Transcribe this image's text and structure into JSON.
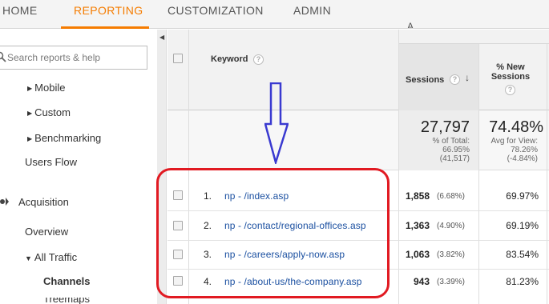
{
  "nav": {
    "tabs": [
      {
        "label": "HOME"
      },
      {
        "label": "REPORTING"
      },
      {
        "label": "CUSTOMIZATION"
      },
      {
        "label": "ADMIN"
      }
    ]
  },
  "sidebar": {
    "search_placeholder": "Search reports & help",
    "items": [
      {
        "label": "Mobile"
      },
      {
        "label": "Custom"
      },
      {
        "label": "Benchmarking"
      },
      {
        "label": "Users Flow"
      },
      {
        "label": "Acquisition"
      },
      {
        "label": "Overview"
      },
      {
        "label": "All Traffic"
      },
      {
        "label": "Channels"
      },
      {
        "label": "Treemaps"
      }
    ]
  },
  "table": {
    "header_top": "A",
    "columns": {
      "keyword": "Keyword",
      "sessions": "Sessions",
      "new_sessions": "% New Sessions"
    },
    "summary": {
      "sessions_total": "27,797",
      "sessions_note_1": "% of Total:",
      "sessions_note_2": "66.95%",
      "sessions_note_3": "(41,517)",
      "new_total": "74.48%",
      "new_note_1": "Avg for View:",
      "new_note_2": "78.26%",
      "new_note_3": "(-4.84%)"
    },
    "rows": [
      {
        "num": "1.",
        "keyword": "np - /index.asp",
        "sessions": "1,858",
        "pct": "(6.68%)",
        "new": "69.97%"
      },
      {
        "num": "2.",
        "keyword": "np - /contact/regional-offices.asp",
        "sessions": "1,363",
        "pct": "(4.90%)",
        "new": "69.19%"
      },
      {
        "num": "3.",
        "keyword": "np - /careers/apply-now.asp",
        "sessions": "1,063",
        "pct": "(3.82%)",
        "new": "83.54%"
      },
      {
        "num": "4.",
        "keyword": "np - /about-us/the-company.asp",
        "sessions": "943",
        "pct": "(3.39%)",
        "new": "81.23%"
      }
    ]
  },
  "colors": {
    "accent": "#f57c00",
    "link": "#1a4fa0",
    "annotation_box": "#e11a22",
    "annotation_arrow": "#3a3ad0"
  }
}
